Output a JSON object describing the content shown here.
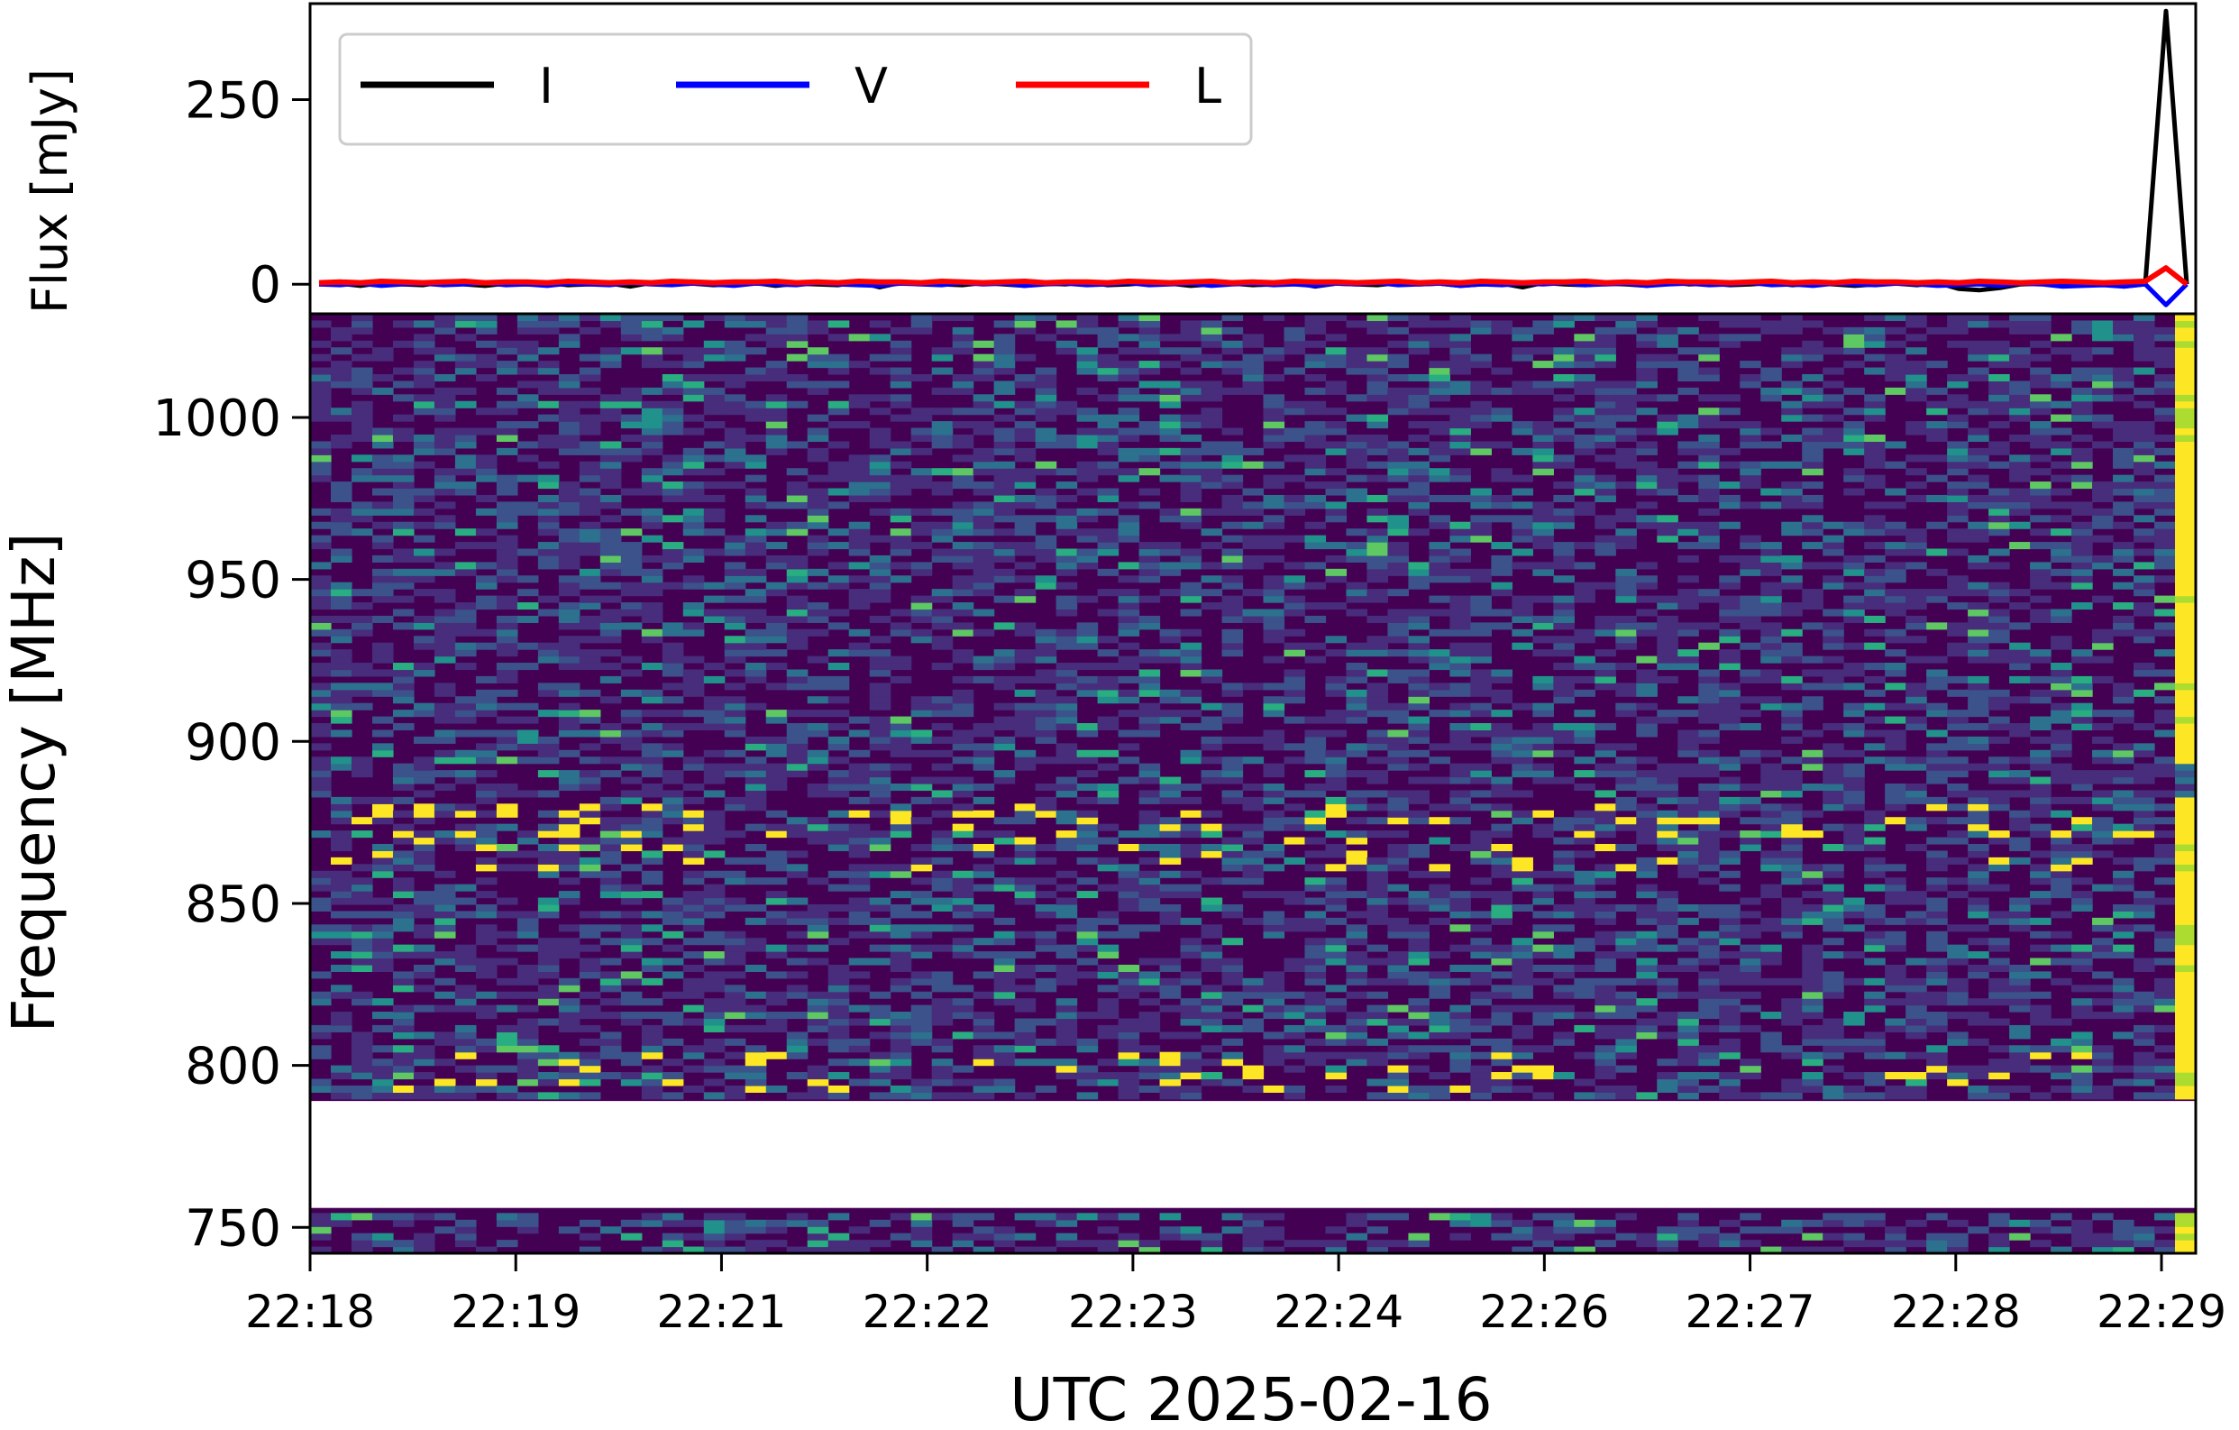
{
  "chart_data": [
    {
      "type": "line",
      "ylabel": "Flux [mJy]",
      "ylim": [
        -40,
        380
      ],
      "yticks": [
        "0",
        "250"
      ],
      "ytick_values": [
        0,
        250
      ],
      "legend_position": "upper-left",
      "series": [
        {
          "name": "I",
          "color": "#000000",
          "values": [
            0,
            1,
            -2,
            2,
            0,
            -1,
            3,
            0,
            -2,
            1,
            0,
            2,
            -1,
            0,
            1,
            -3,
            2,
            0,
            1,
            -1,
            0,
            2,
            -2,
            1,
            0,
            -1,
            3,
            -4,
            2,
            1,
            0,
            -1,
            2,
            0,
            -2,
            1,
            0,
            3,
            -1,
            0,
            2,
            1,
            -2,
            0,
            1,
            -1,
            0,
            2,
            -3,
            1,
            0,
            -1,
            2,
            0,
            1,
            -2,
            0,
            1,
            -4,
            2,
            0,
            -1,
            1,
            0,
            -2,
            3,
            0,
            1,
            -1,
            0,
            2,
            -1,
            1,
            0,
            -2,
            0,
            1,
            -1,
            2,
            -6,
            -8,
            -5,
            0,
            1,
            -2,
            0,
            1,
            -3,
            0,
            370,
            0
          ]
        },
        {
          "name": "V",
          "color": "#0000ff",
          "values": [
            0,
            -1,
            1,
            -2,
            0,
            1,
            -1,
            0,
            2,
            -1,
            0,
            -2,
            1,
            0,
            -1,
            2,
            0,
            -1,
            1,
            0,
            -2,
            1,
            0,
            -1,
            2,
            0,
            -1,
            -2,
            1,
            0,
            -1,
            2,
            0,
            1,
            -2,
            0,
            1,
            -1,
            0,
            2,
            -1,
            0,
            1,
            -2,
            0,
            1,
            -1,
            0,
            -2,
            1,
            0,
            2,
            -1,
            0,
            1,
            -2,
            0,
            -1,
            1,
            0,
            2,
            -1,
            0,
            1,
            -2,
            0,
            1,
            -1,
            0,
            2,
            -1,
            0,
            -2,
            1,
            0,
            -1,
            1,
            0,
            -2,
            -1,
            0,
            -2,
            1,
            0,
            -3,
            -2,
            -1,
            -3,
            0,
            -28,
            0
          ]
        },
        {
          "name": "L",
          "color": "#ff0000",
          "values": [
            2,
            3,
            2,
            4,
            3,
            2,
            3,
            4,
            2,
            3,
            3,
            2,
            4,
            3,
            2,
            3,
            2,
            4,
            3,
            2,
            3,
            3,
            4,
            2,
            3,
            2,
            4,
            3,
            3,
            2,
            4,
            3,
            2,
            3,
            4,
            2,
            3,
            3,
            2,
            4,
            3,
            2,
            3,
            4,
            2,
            3,
            2,
            4,
            3,
            3,
            2,
            3,
            4,
            2,
            3,
            2,
            4,
            3,
            2,
            3,
            3,
            4,
            2,
            3,
            2,
            4,
            3,
            3,
            2,
            3,
            4,
            2,
            3,
            2,
            4,
            3,
            3,
            2,
            3,
            2,
            4,
            3,
            2,
            3,
            4,
            3,
            2,
            3,
            4,
            22,
            0
          ]
        }
      ]
    },
    {
      "type": "heatmap",
      "xlabel": "UTC 2025-02-16",
      "ylabel": "Frequency [MHz]",
      "ylim": [
        742,
        1032
      ],
      "yticks": [
        "750",
        "800",
        "850",
        "900",
        "950",
        "1000"
      ],
      "ytick_values": [
        750,
        800,
        850,
        900,
        950,
        1000
      ],
      "xticks": [
        "22:18",
        "22:19",
        "22:21",
        "22:22",
        "22:23",
        "22:24",
        "22:26",
        "22:27",
        "22:28",
        "22:29"
      ],
      "n_time": 91,
      "n_freq": 140,
      "masked_band_mhz": [
        756,
        789
      ],
      "colormap": [
        "#440154",
        "#472d7b",
        "#3b528b",
        "#2c728e",
        "#21918c",
        "#28ae80",
        "#5ec962",
        "#addc30",
        "#fde725"
      ],
      "bright_column": 90,
      "bright_band_mhz": [
        860,
        882
      ]
    }
  ]
}
